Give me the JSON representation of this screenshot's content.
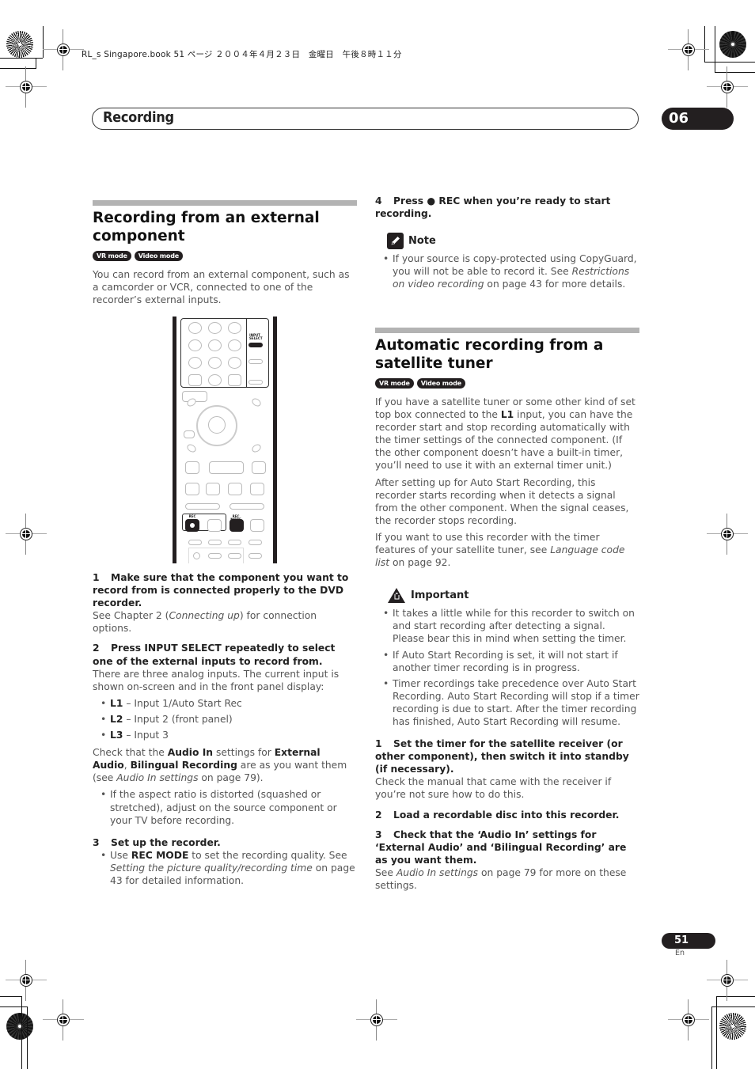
{
  "print_header": "RL_s Singapore.book  51 ページ  ２００４年４月２３日　金曜日　午後８時１１分",
  "chapter": {
    "title": "Recording",
    "number": "06"
  },
  "left": {
    "section_title": "Recording from an external component",
    "badges": [
      "VR mode",
      "Video mode"
    ],
    "intro": "You can record from an external component, such as a camcorder or VCR, connected to one of the recorder’s external inputs.",
    "remote_labels": {
      "input_select": "INPUT SELECT",
      "rec": "REC",
      "rec_mode": "REC MODE"
    },
    "step1": {
      "num": "1",
      "title": "Make sure that the component you want to record from is connected properly to the DVD recorder.",
      "body_pre": "See Chapter 2 (",
      "body_italic": "Connecting up",
      "body_post": ") for connection options."
    },
    "step2": {
      "num": "2",
      "title": "Press INPUT SELECT repeatedly to select one of the external inputs to record from.",
      "body": "There are three analog inputs. The current input is shown on-screen and in the front panel display:",
      "inputs": [
        {
          "key": "L1",
          "desc": " – Input 1/Auto Start Rec"
        },
        {
          "key": "L2",
          "desc": " – Input 2 (front panel)"
        },
        {
          "key": "L3",
          "desc": " – Input 3"
        }
      ],
      "check": {
        "t1": "Check that the ",
        "b1": "Audio In",
        "t2": " settings for ",
        "b2": "External Audio",
        "t3": ", ",
        "b3": "Bilingual Recording",
        "t4": " are as you want them (see ",
        "i1": "Audio In settings",
        "t5": " on page 79)."
      },
      "aspect_note": "If the aspect ratio is distorted (squashed or stretched), adjust on the source component or your TV before recording."
    },
    "step3": {
      "num": "3",
      "title": "Set up the recorder.",
      "bullet_pre": "Use ",
      "bullet_bold": "REC MODE",
      "bullet_mid": " to set the recording quality. See ",
      "bullet_italic": "Setting the picture quality/recording time",
      "bullet_post": " on page 43 for detailed information."
    }
  },
  "right": {
    "step4": {
      "num": "4",
      "title": "Press ● REC when you’re ready to start recording."
    },
    "note": {
      "label": "Note",
      "pre": "If your source is copy-protected using CopyGuard, you will not be able to record it. See ",
      "italic": "Restrictions on video recording",
      "post": " on page 43 for more details."
    },
    "section_title": "Automatic recording from a satellite tuner",
    "badges": [
      "VR mode",
      "Video mode"
    ],
    "intro": {
      "pre": "If you have a satellite tuner or some other kind of set top box connected to the ",
      "bold": "L1",
      "post": " input, you can have the recorder start and stop recording automatically with the timer settings of the connected component. (If the other component doesn’t have a built-in timer, you’ll need to use it with an external timer unit.)"
    },
    "para2": "After setting up for Auto Start Recording, this recorder starts recording when it detects a signal from the other component. When the signal ceases, the recorder stops recording.",
    "para3": {
      "pre": "If you want to use this recorder with the timer features of your satellite tuner, see ",
      "italic": "Language code list",
      "post": " on page 92."
    },
    "important": {
      "label": "Important",
      "items": [
        "It takes a little while for this recorder to switch on and start recording after detecting a signal. Please bear this in mind when setting the timer.",
        "If Auto Start Recording is set, it will not start if another timer recording is in progress.",
        "Timer recordings take precedence over Auto Start Recording. Auto Start Recording will stop if a timer recording is due to start. After the timer recording has finished, Auto Start Recording will resume."
      ]
    },
    "step1": {
      "num": "1",
      "title": "Set the timer for the satellite receiver (or other component), then switch it into standby (if necessary).",
      "body": "Check the manual that came with the receiver if you’re not sure how to do this."
    },
    "step2": {
      "num": "2",
      "title": "Load a recordable disc into this recorder."
    },
    "step3": {
      "num": "3",
      "title": "Check that the ‘Audio In’ settings for ‘External Audio’ and ‘Bilingual Recording’ are as you want them.",
      "pre": "See ",
      "italic": "Audio In settings",
      "post": " on page 79 for more on these settings."
    }
  },
  "footer": {
    "page": "51",
    "lang": "En"
  }
}
